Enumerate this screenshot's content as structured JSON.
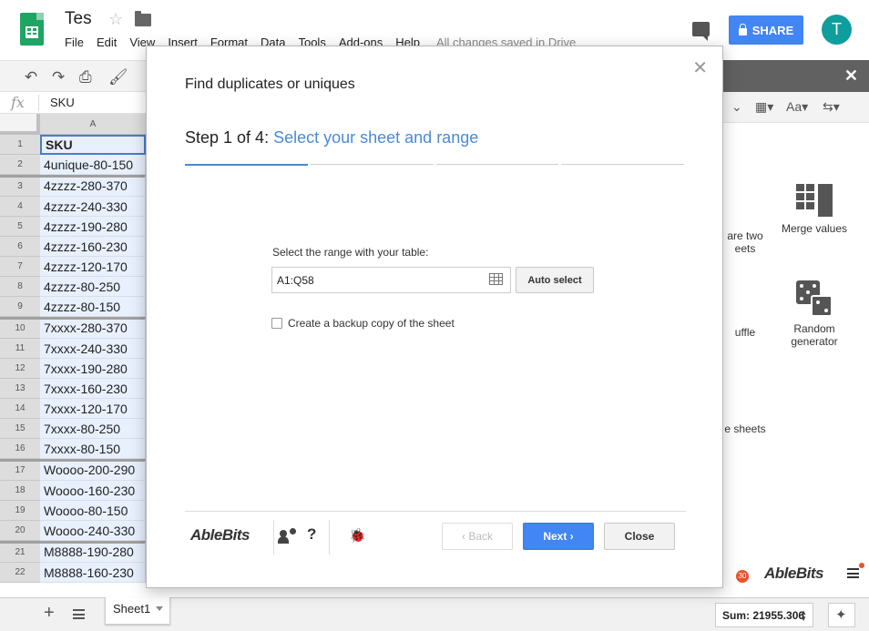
{
  "app": {
    "doc_title": "Tes",
    "menu": [
      "File",
      "Edit",
      "View",
      "Insert",
      "Format",
      "Data",
      "Tools",
      "Add-ons",
      "Help"
    ],
    "save_status": "All changes saved in Drive",
    "share_label": "SHARE",
    "avatar_initial": "T",
    "accent_color": "#4285f4"
  },
  "formula_bar": {
    "fx_label": "fx",
    "value": "SKU"
  },
  "grid": {
    "column_header": "A",
    "rows": [
      {
        "num": "1",
        "value": "SKU"
      },
      {
        "num": "2",
        "value": "4unique-80-150"
      },
      {
        "num": "3",
        "value": "4zzzz-280-370"
      },
      {
        "num": "4",
        "value": "4zzzz-240-330"
      },
      {
        "num": "5",
        "value": "4zzzz-190-280"
      },
      {
        "num": "6",
        "value": "4zzzz-160-230"
      },
      {
        "num": "7",
        "value": "4zzzz-120-170"
      },
      {
        "num": "8",
        "value": "4zzzz-80-250"
      },
      {
        "num": "9",
        "value": "4zzzz-80-150"
      },
      {
        "num": "10",
        "value": "7xxxx-280-370"
      },
      {
        "num": "11",
        "value": "7xxxx-240-330"
      },
      {
        "num": "12",
        "value": "7xxxx-190-280"
      },
      {
        "num": "13",
        "value": "7xxxx-160-230"
      },
      {
        "num": "14",
        "value": "7xxxx-120-170"
      },
      {
        "num": "15",
        "value": "7xxxx-80-250"
      },
      {
        "num": "16",
        "value": "7xxxx-80-150"
      },
      {
        "num": "17",
        "value": "Woooo-200-290"
      },
      {
        "num": "18",
        "value": "Woooo-160-230"
      },
      {
        "num": "19",
        "value": "Woooo-80-150"
      },
      {
        "num": "20",
        "value": "Woooo-240-330"
      },
      {
        "num": "21",
        "value": "M8888-190-280"
      },
      {
        "num": "22",
        "value": "M8888-160-230"
      }
    ]
  },
  "sidebar": {
    "tiles": [
      {
        "label": "are two\neets"
      },
      {
        "label": "Merge values"
      },
      {
        "label": "uffle"
      },
      {
        "label": "Random\ngenerator"
      },
      {
        "label": "e sheets"
      }
    ],
    "brand": "AbleBits",
    "badge_count": "30"
  },
  "bottom": {
    "sheet_tab": "Sheet1",
    "sum": "Sum: 21955.306"
  },
  "dialog": {
    "title": "Find duplicates or uniques",
    "step_prefix": "Step 1 of 4: ",
    "step_name": "Select your sheet and range",
    "range_label": "Select the range with your table:",
    "range_value": "A1:Q58",
    "auto_select": "Auto select",
    "backup_label": "Create a backup copy of the sheet",
    "backup_checked": false,
    "brand": "AbleBits",
    "help": "?",
    "back": "Back",
    "next": "Next",
    "close": "Close",
    "progress_steps": 4,
    "current_step": 1
  }
}
